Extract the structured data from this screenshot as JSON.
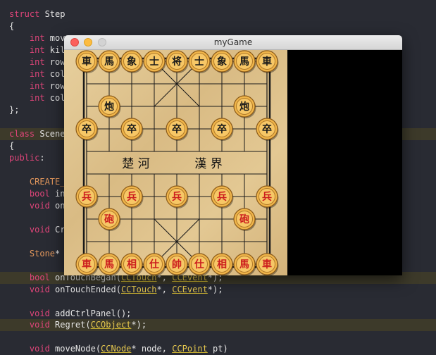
{
  "editor": {
    "lines": [
      {
        "segments": [
          {
            "t": "struct",
            "c": "kw"
          },
          {
            "t": " Step",
            "c": "pl"
          }
        ]
      },
      {
        "segments": [
          {
            "t": "{",
            "c": "pl"
          }
        ]
      },
      {
        "segments": [
          {
            "t": "    int",
            "c": "kw"
          },
          {
            "t": " mov",
            "c": "pl"
          }
        ]
      },
      {
        "segments": [
          {
            "t": "    int",
            "c": "kw"
          },
          {
            "t": " kil",
            "c": "pl"
          }
        ]
      },
      {
        "segments": [
          {
            "t": "    int",
            "c": "kw"
          },
          {
            "t": " row",
            "c": "pl"
          }
        ]
      },
      {
        "segments": [
          {
            "t": "    int",
            "c": "kw"
          },
          {
            "t": " col",
            "c": "pl"
          }
        ]
      },
      {
        "segments": [
          {
            "t": "    int",
            "c": "kw"
          },
          {
            "t": " row",
            "c": "pl"
          }
        ]
      },
      {
        "segments": [
          {
            "t": "    int",
            "c": "kw"
          },
          {
            "t": " col",
            "c": "pl"
          }
        ]
      },
      {
        "segments": [
          {
            "t": "};",
            "c": "pl"
          }
        ]
      },
      {
        "segments": []
      },
      {
        "segments": [
          {
            "t": "class",
            "c": "kw"
          },
          {
            "t": " Scene",
            "c": "pl"
          }
        ],
        "hl": true
      },
      {
        "segments": [
          {
            "t": "{",
            "c": "pl"
          }
        ]
      },
      {
        "segments": [
          {
            "t": "public",
            "c": "kw"
          },
          {
            "t": ":",
            "c": "pl"
          }
        ]
      },
      {
        "segments": []
      },
      {
        "segments": [
          {
            "t": "    CREATE_",
            "c": "tp"
          }
        ]
      },
      {
        "segments": [
          {
            "t": "    bool",
            "c": "kw"
          },
          {
            "t": " in",
            "c": "pl"
          }
        ]
      },
      {
        "segments": [
          {
            "t": "    void",
            "c": "kw"
          },
          {
            "t": " on",
            "c": "pl"
          }
        ]
      },
      {
        "segments": []
      },
      {
        "segments": [
          {
            "t": "    void",
            "c": "kw"
          },
          {
            "t": " Cr",
            "c": "pl"
          }
        ]
      },
      {
        "segments": []
      },
      {
        "segments": [
          {
            "t": "    Stone",
            "c": "tp"
          },
          {
            "t": "*",
            "c": "pl"
          }
        ]
      },
      {
        "segments": []
      },
      {
        "segments": [
          {
            "t": "    bool",
            "c": "kw"
          },
          {
            "t": " onTouchBegan(",
            "c": "pl"
          },
          {
            "t": "CCTouch",
            "c": "cl"
          },
          {
            "t": "*, ",
            "c": "pl"
          },
          {
            "t": "CCEvent",
            "c": "cl"
          },
          {
            "t": "*);",
            "c": "pl"
          }
        ],
        "hl": true
      },
      {
        "segments": [
          {
            "t": "    void",
            "c": "kw"
          },
          {
            "t": " onTouchEnded(",
            "c": "pl"
          },
          {
            "t": "CCTouch",
            "c": "cl"
          },
          {
            "t": "*, ",
            "c": "pl"
          },
          {
            "t": "CCEvent",
            "c": "cl"
          },
          {
            "t": "*);",
            "c": "pl"
          }
        ]
      },
      {
        "segments": []
      },
      {
        "segments": [
          {
            "t": "    void",
            "c": "kw"
          },
          {
            "t": " addCtrlPanel();",
            "c": "pl"
          }
        ]
      },
      {
        "segments": [
          {
            "t": "    void",
            "c": "kw"
          },
          {
            "t": " Regret(",
            "c": "pl"
          },
          {
            "t": "CCObject",
            "c": "cl"
          },
          {
            "t": "*);",
            "c": "pl"
          }
        ],
        "hl": true
      },
      {
        "segments": []
      },
      {
        "segments": [
          {
            "t": "    void",
            "c": "kw"
          },
          {
            "t": " moveNode(",
            "c": "pl"
          },
          {
            "t": "CCNode",
            "c": "cl"
          },
          {
            "t": "* node, ",
            "c": "pl"
          },
          {
            "t": "CCPoint",
            "c": "cl"
          },
          {
            "t": " pt)",
            "c": "pl"
          }
        ]
      }
    ]
  },
  "window": {
    "title": "myGame",
    "river_left": "楚 河",
    "river_right": "漢 界"
  },
  "colors": {
    "black_side": "#1a1a1a",
    "red_side": "#cc1e1e",
    "piece_face": "#f0b54a"
  },
  "pieces": [
    {
      "label": "車",
      "side": "black",
      "col": 0,
      "row": 0
    },
    {
      "label": "馬",
      "side": "black",
      "col": 1,
      "row": 0
    },
    {
      "label": "象",
      "side": "black",
      "col": 2,
      "row": 0
    },
    {
      "label": "士",
      "side": "black",
      "col": 3,
      "row": 0
    },
    {
      "label": "将",
      "side": "black",
      "col": 4,
      "row": 0
    },
    {
      "label": "士",
      "side": "black",
      "col": 5,
      "row": 0
    },
    {
      "label": "象",
      "side": "black",
      "col": 6,
      "row": 0
    },
    {
      "label": "馬",
      "side": "black",
      "col": 7,
      "row": 0
    },
    {
      "label": "車",
      "side": "black",
      "col": 8,
      "row": 0
    },
    {
      "label": "炮",
      "side": "black",
      "col": 1,
      "row": 2
    },
    {
      "label": "炮",
      "side": "black",
      "col": 7,
      "row": 2
    },
    {
      "label": "卒",
      "side": "black",
      "col": 0,
      "row": 3
    },
    {
      "label": "卒",
      "side": "black",
      "col": 2,
      "row": 3
    },
    {
      "label": "卒",
      "side": "black",
      "col": 4,
      "row": 3
    },
    {
      "label": "卒",
      "side": "black",
      "col": 6,
      "row": 3
    },
    {
      "label": "卒",
      "side": "black",
      "col": 8,
      "row": 3
    },
    {
      "label": "兵",
      "side": "red",
      "col": 0,
      "row": 6
    },
    {
      "label": "兵",
      "side": "red",
      "col": 2,
      "row": 6
    },
    {
      "label": "兵",
      "side": "red",
      "col": 4,
      "row": 6
    },
    {
      "label": "兵",
      "side": "red",
      "col": 6,
      "row": 6
    },
    {
      "label": "兵",
      "side": "red",
      "col": 8,
      "row": 6
    },
    {
      "label": "砲",
      "side": "red",
      "col": 1,
      "row": 7
    },
    {
      "label": "砲",
      "side": "red",
      "col": 7,
      "row": 7
    },
    {
      "label": "車",
      "side": "red",
      "col": 0,
      "row": 9
    },
    {
      "label": "馬",
      "side": "red",
      "col": 1,
      "row": 9
    },
    {
      "label": "相",
      "side": "red",
      "col": 2,
      "row": 9
    },
    {
      "label": "仕",
      "side": "red",
      "col": 3,
      "row": 9
    },
    {
      "label": "帥",
      "side": "red",
      "col": 4,
      "row": 9
    },
    {
      "label": "仕",
      "side": "red",
      "col": 5,
      "row": 9
    },
    {
      "label": "相",
      "side": "red",
      "col": 6,
      "row": 9
    },
    {
      "label": "馬",
      "side": "red",
      "col": 7,
      "row": 9
    },
    {
      "label": "車",
      "side": "red",
      "col": 8,
      "row": 9
    }
  ]
}
